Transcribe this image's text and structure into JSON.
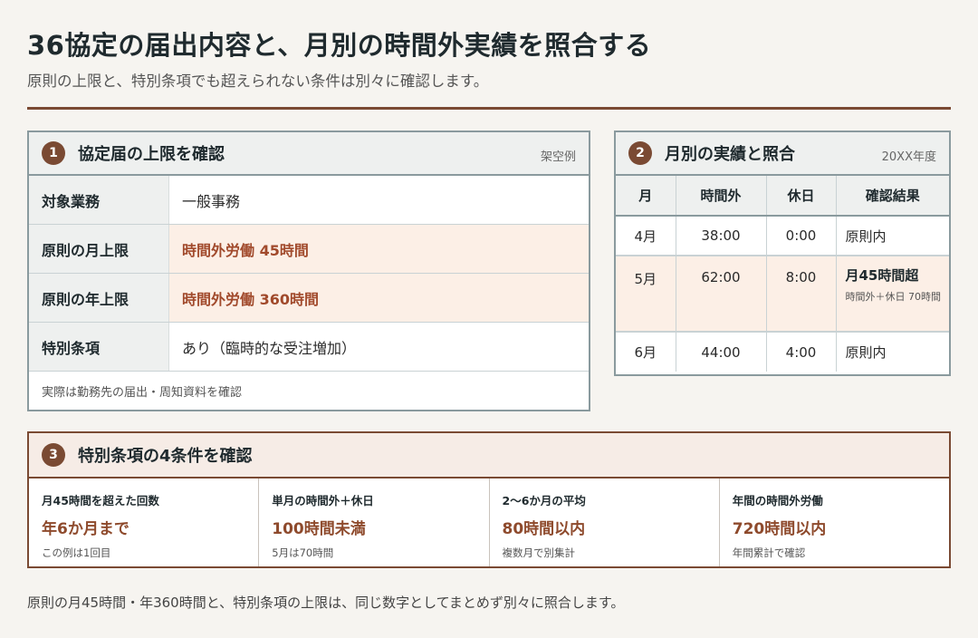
{
  "header": {
    "title": "36協定の届出内容と、月別の時間外実績を照合する",
    "subtitle": "原則の上限と、特別条項でも超えられない条件は別々に確認します。"
  },
  "panel1": {
    "number": "1",
    "title": "協定届の上限を確認",
    "tag": "架空例",
    "rows": [
      {
        "label": "対象業務",
        "value": "一般事務"
      },
      {
        "label": "原則の月上限",
        "value": "時間外労働 45時間"
      },
      {
        "label": "原則の年上限",
        "value": "時間外労働 360時間"
      },
      {
        "label": "特別条項",
        "value": "あり（臨時的な受注増加）"
      }
    ],
    "note": "実際は勤務先の届出・周知資料を確認"
  },
  "panel2": {
    "number": "2",
    "title": "月別の実績と照合",
    "tag": "20XX年度",
    "columns": [
      "月",
      "時間外",
      "休日",
      "確認結果"
    ],
    "rows": [
      {
        "month": "4月",
        "overtime": "38:00",
        "holiday": "0:00",
        "result": "原則内",
        "note": ""
      },
      {
        "month": "5月",
        "overtime": "62:00",
        "holiday": "8:00",
        "result": "月45時間超",
        "note": "時間外＋休日 70時間"
      },
      {
        "month": "6月",
        "overtime": "44:00",
        "holiday": "4:00",
        "result": "原則内",
        "note": ""
      }
    ]
  },
  "panel3": {
    "number": "3",
    "title": "特別条項の4条件を確認",
    "conditions": [
      {
        "label": "月45時間を超えた回数",
        "value": "年6か月まで",
        "note": "この例は1回目"
      },
      {
        "label": "単月の時間外＋休日",
        "value": "100時間未満",
        "note": "5月は70時間"
      },
      {
        "label": "2〜6か月の平均",
        "value": "80時間以内",
        "note": "複数月で別集計"
      },
      {
        "label": "年間の時間外労働",
        "value": "720時間以内",
        "note": "年間累計で確認"
      }
    ]
  },
  "footer": "原則の月45時間・年360時間と、特別条項の上限は、同じ数字としてまとめず別々に照合します。",
  "colors": {
    "accent": "#7a4a33",
    "highlight": "#fcefe6",
    "value_text": "#a14a2c"
  }
}
